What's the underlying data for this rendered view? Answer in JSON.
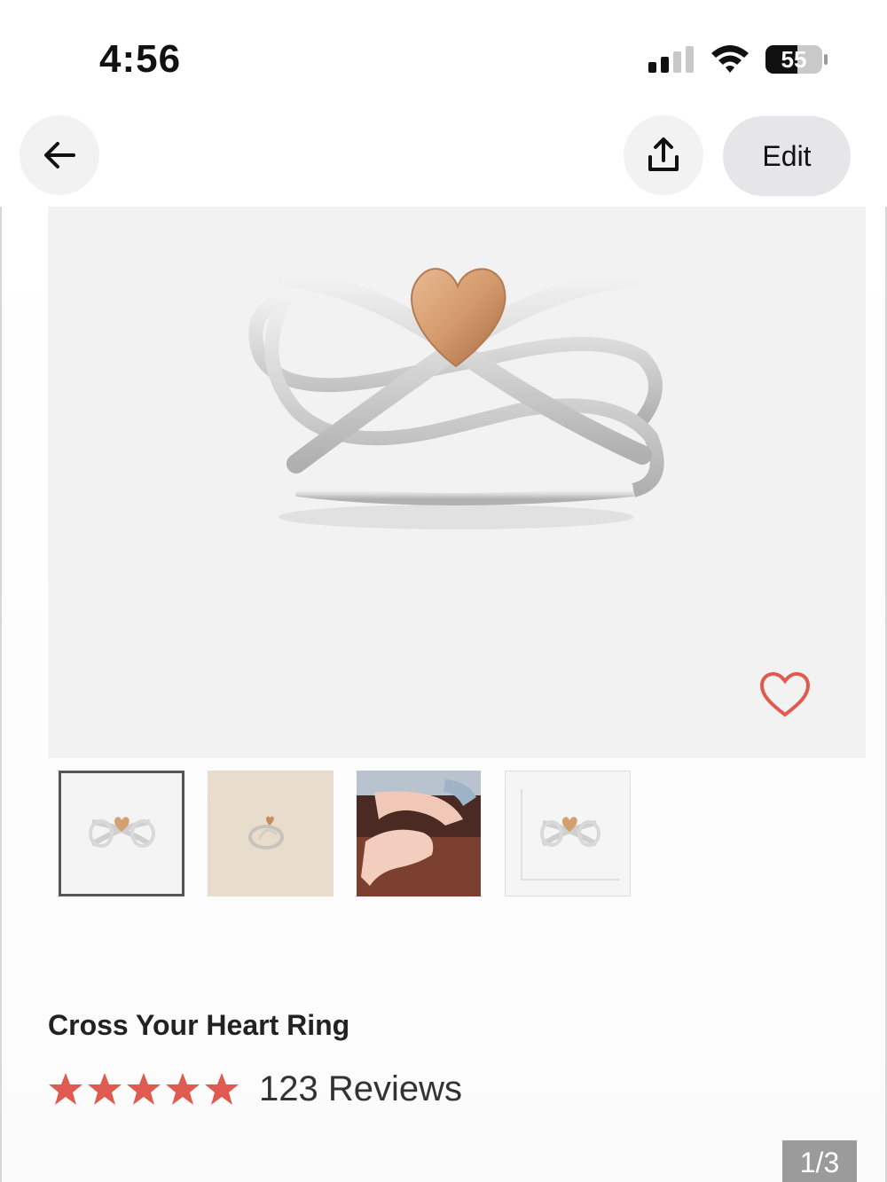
{
  "status_bar": {
    "time": "4:56",
    "battery_level": "55",
    "signal_bars": 2
  },
  "nav": {
    "back_icon": "arrow-left-icon",
    "share_icon": "share-upload-icon",
    "edit_label": "Edit"
  },
  "product": {
    "title": "Cross Your Heart Ring",
    "rating_stars": 5,
    "reviews": "123 Reviews",
    "favorite_icon": "heart-outline-icon",
    "accent_color": "#e05a50",
    "thumbnails": [
      {
        "name": "thumbnail-ring-front"
      },
      {
        "name": "thumbnail-ring-angle"
      },
      {
        "name": "thumbnail-ring-on-hand"
      },
      {
        "name": "thumbnail-ring-size-chart"
      }
    ]
  },
  "gallery": {
    "page_indicator": "1/3"
  }
}
